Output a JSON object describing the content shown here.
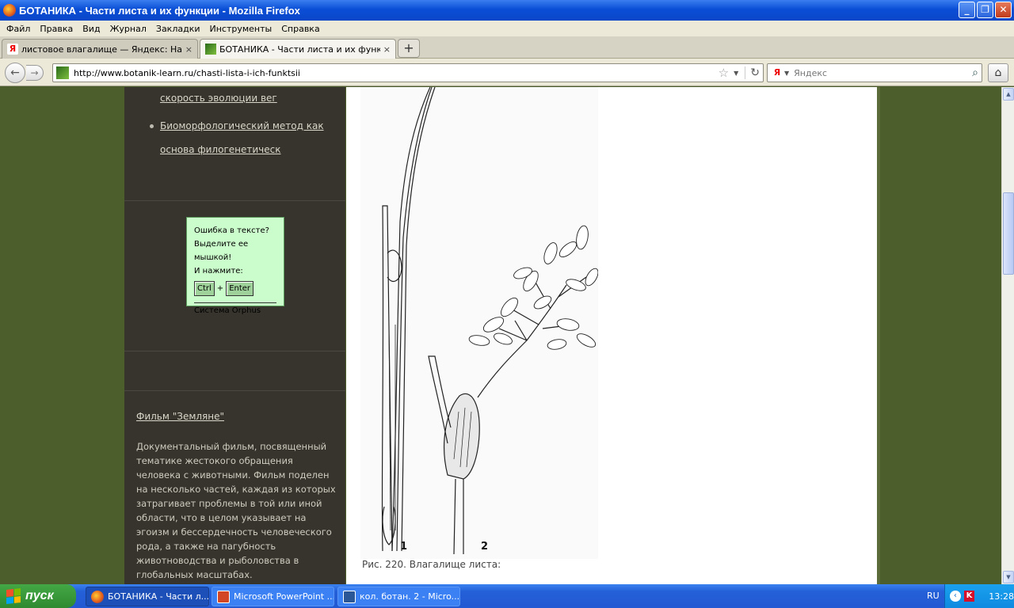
{
  "window": {
    "title": "БОТАНИКА - Части листа и их функции - Mozilla Firefox",
    "min": "_",
    "max": "❐",
    "close": "✕"
  },
  "menu": [
    "Файл",
    "Правка",
    "Вид",
    "Журнал",
    "Закладки",
    "Инструменты",
    "Справка"
  ],
  "tabs": [
    {
      "label": "листовое влагалище — Яндекс: Нашл...",
      "close": "×",
      "icon": "yandex-icon"
    },
    {
      "label": "БОТАНИКА - Части листа и их функции",
      "close": "×",
      "icon": "site-leaf-icon"
    }
  ],
  "new_tab": "+",
  "nav": {
    "back": "←",
    "forward": "→",
    "url": "http://www.botanik-learn.ru/chasti-lista-i-ich-funktsii",
    "search_placeholder": "Яндекс",
    "yandex_letter": "Я"
  },
  "sidebar": {
    "links": [
      {
        "label": "скорость эволюции вег"
      },
      {
        "label": "Биоморфологический метод как"
      },
      {
        "label": "основа филогенетическ"
      }
    ],
    "orphus": {
      "line1": "Ошибка в тексте?",
      "line2": "Выделите ее мышкой!",
      "line3": "И нажмите:",
      "key1": "Ctrl",
      "plus": "+",
      "key2": "Enter",
      "system": "Система Orphus"
    },
    "film": {
      "link": "Фильм \"Земляне\"",
      "description": "Документальный фильм, посвященный тематике жестокого обращения человека с животными. Фильм поделен на несколько частей, каждая из которых затрагивает проблемы в той или иной области, что в целом указывает на эгоизм и бессердечность человеческого рода, а также на пагубность животноводства и рыболовства в глобальных масштабах."
    }
  },
  "figure": {
    "label1": "1",
    "label2": "2",
    "caption": "Рис. 220. Влагалище листа:"
  },
  "taskbar": {
    "start": "пуск",
    "buttons": [
      {
        "label": "БОТАНИКА - Части л...",
        "icon": "firefox-icon"
      },
      {
        "label": "Microsoft PowerPoint ...",
        "icon": "powerpoint-icon"
      },
      {
        "label": "кол. ботан. 2 - Micro...",
        "icon": "word-icon"
      }
    ],
    "lang": "RU",
    "clock": "13:28"
  }
}
